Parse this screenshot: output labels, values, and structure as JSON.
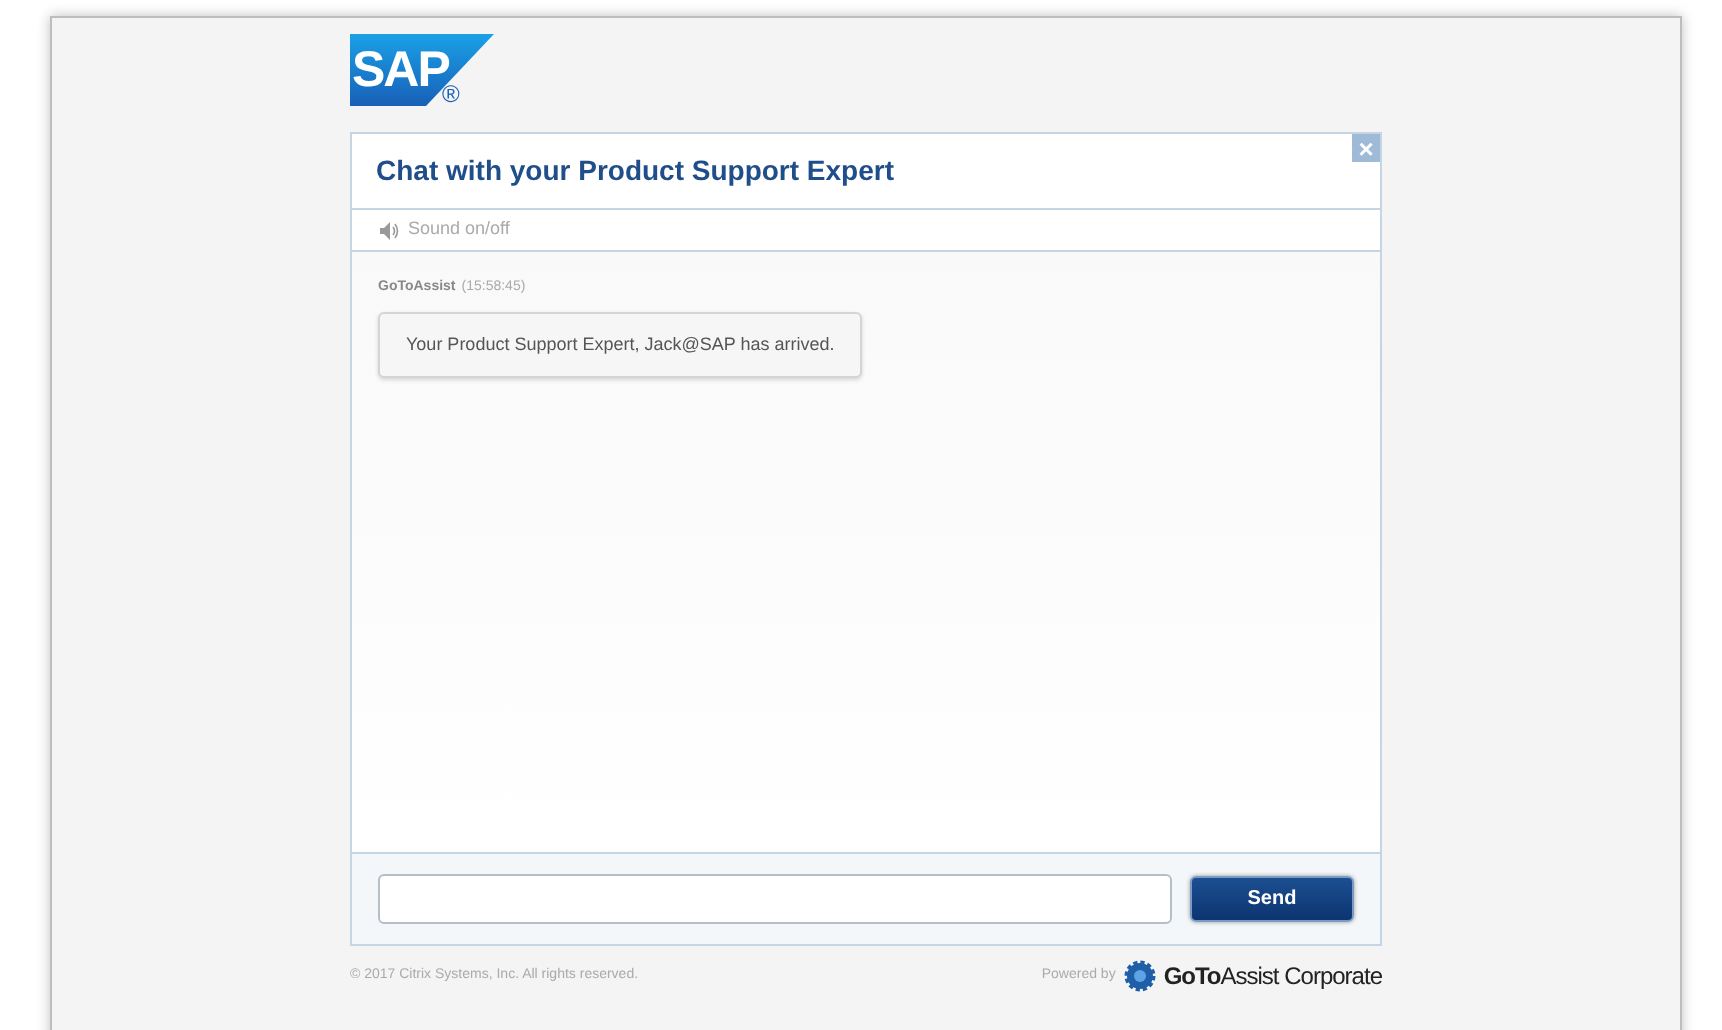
{
  "logo": {
    "text": "SAP",
    "mark": "®"
  },
  "chat": {
    "close": "×",
    "title": "Chat with your Product Support Expert",
    "sound_toggle": "Sound on/off",
    "messages": [
      {
        "sender": "GoToAssist",
        "time": "(15:58:45)",
        "text": "Your Product Support Expert, Jack@SAP has arrived."
      }
    ],
    "send": "Send"
  },
  "footer": {
    "copyright": "© 2017 Citrix Systems, Inc. All rights reserved.",
    "powered_by": "Powered by",
    "brand_bold": "GoTo",
    "brand_regular": "Assist",
    "brand_suffix": "Corporate"
  }
}
